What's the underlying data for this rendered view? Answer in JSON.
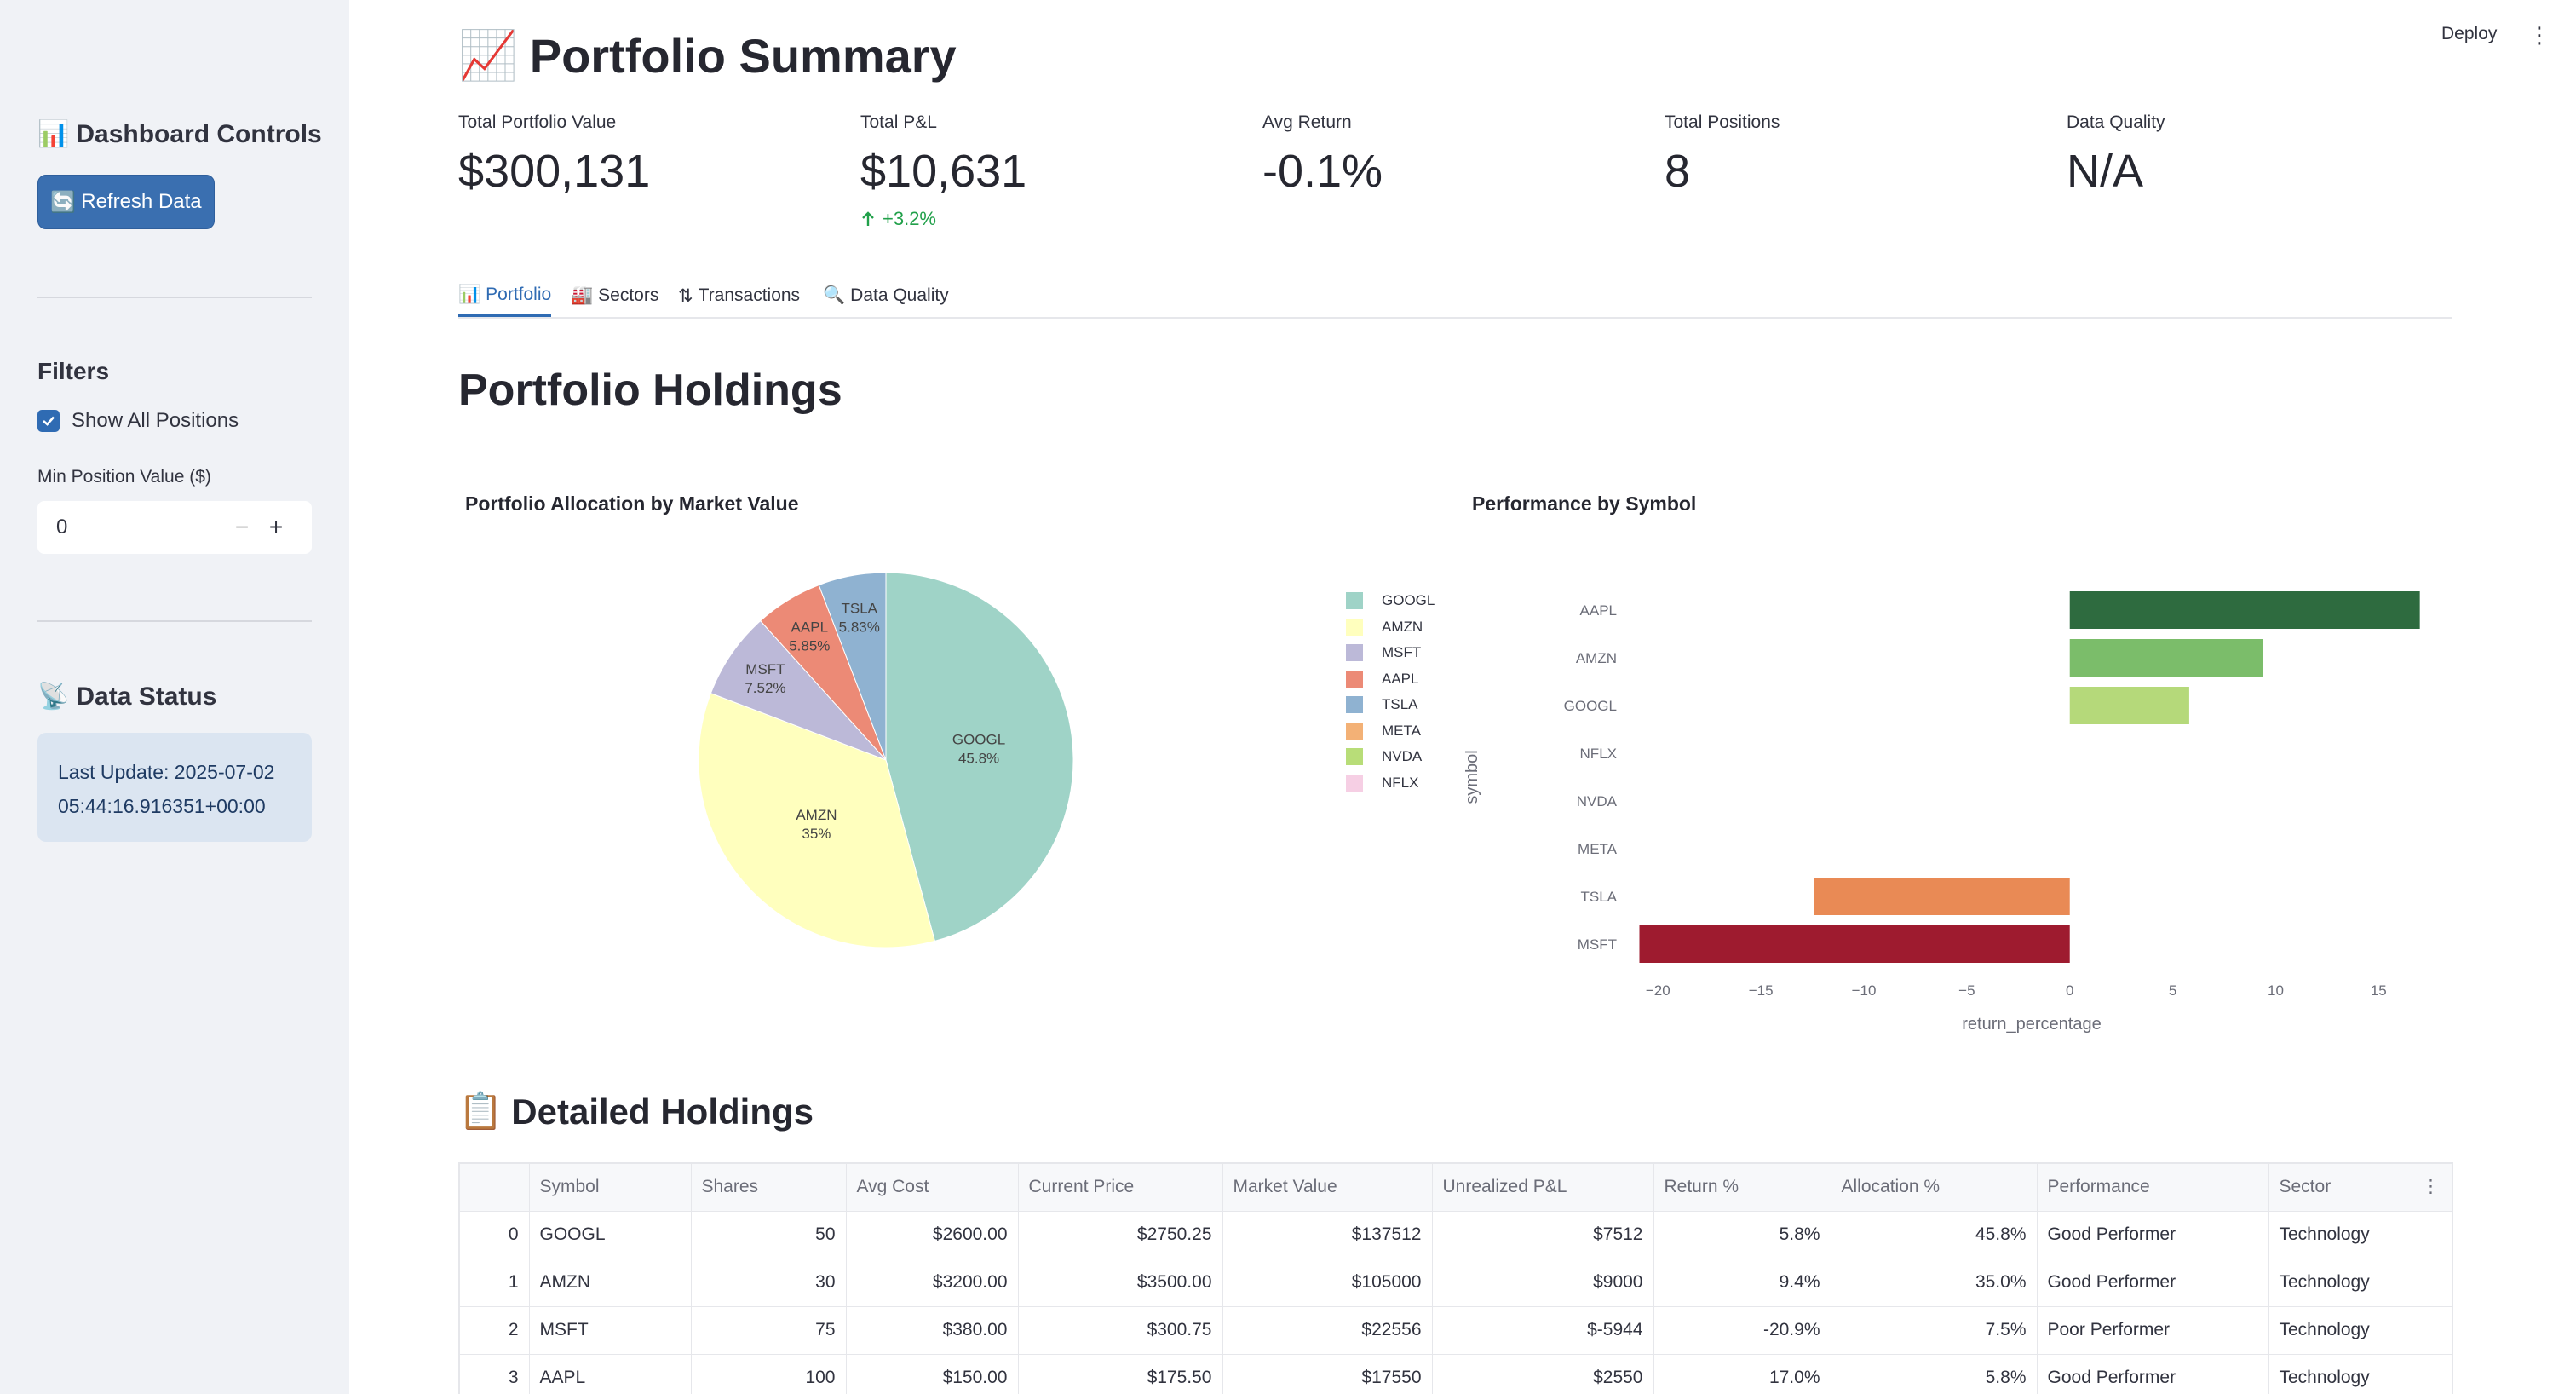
{
  "sidebar": {
    "controls_title": "Dashboard Controls",
    "refresh_label": "Refresh Data",
    "filters_title": "Filters",
    "show_all_label": "Show All Positions",
    "min_value_label": "Min Position Value ($)",
    "min_value": "0",
    "status_title": "Data Status",
    "last_update_line1": "Last Update: 2025-07-02",
    "last_update_line2": "05:44:16.916351+00:00"
  },
  "header": {
    "deploy_label": "Deploy"
  },
  "page": {
    "title": "Portfolio Summary"
  },
  "metrics": [
    {
      "label": "Total Portfolio Value",
      "value": "$300,131"
    },
    {
      "label": "Total P&L",
      "value": "$10,631",
      "delta": "+3.2%"
    },
    {
      "label": "Avg Return",
      "value": "-0.1%"
    },
    {
      "label": "Total Positions",
      "value": "8"
    },
    {
      "label": "Data Quality",
      "value": "N/A"
    }
  ],
  "tabs": [
    "Portfolio",
    "Sectors",
    "Transactions",
    "Data Quality"
  ],
  "section_title": "Portfolio Holdings",
  "detailed_title": "Detailed Holdings",
  "colors": {
    "accent": "#2f6bb3",
    "GOOGL": "#9fd3c7",
    "AMZN": "#ffffbe",
    "MSFT": "#bcb9d8",
    "AAPL": "#ec8a76",
    "TSLA": "#8fb2d1",
    "META": "#f3b176",
    "NVDA": "#b8dd78",
    "NFLX": "#f6cfe4"
  },
  "chart_data": [
    {
      "type": "pie",
      "title": "Portfolio Allocation by Market Value",
      "labels": [
        "GOOGL",
        "AMZN",
        "MSFT",
        "AAPL",
        "TSLA"
      ],
      "slice_labels": [
        "45.8%",
        "35%",
        "7.52%",
        "5.85%",
        "5.83%"
      ],
      "values": [
        45.8,
        35.0,
        7.52,
        5.85,
        5.83
      ],
      "legend": [
        "GOOGL",
        "AMZN",
        "MSFT",
        "AAPL",
        "TSLA",
        "META",
        "NVDA",
        "NFLX"
      ],
      "legend_position": "right"
    },
    {
      "type": "bar",
      "orientation": "horizontal",
      "title": "Performance by Symbol",
      "categories": [
        "AAPL",
        "AMZN",
        "GOOGL",
        "NFLX",
        "NVDA",
        "META",
        "TSLA",
        "MSFT"
      ],
      "values": [
        17.0,
        9.4,
        5.8,
        0,
        0,
        0,
        -12.4,
        -20.9
      ],
      "bar_colors": [
        "#2e6b3f",
        "#7bbd6a",
        "#b5d97a",
        "#ffffff",
        "#ffffff",
        "#ffffff",
        "#e98a55",
        "#9e1b2f"
      ],
      "xlabel": "return_percentage",
      "ylabel": "symbol",
      "xlim": [
        -21.5,
        17.8
      ],
      "xticks": [
        -20,
        -15,
        -10,
        -5,
        0,
        5,
        10,
        15
      ]
    }
  ],
  "table": {
    "columns": [
      "",
      "Symbol",
      "Shares",
      "Avg Cost",
      "Current Price",
      "Market Value",
      "Unrealized P&L",
      "Return %",
      "Allocation %",
      "Performance",
      "Sector"
    ],
    "rows": [
      [
        "0",
        "GOOGL",
        "50",
        "$2600.00",
        "$2750.25",
        "$137512",
        "$7512",
        "5.8%",
        "45.8%",
        "Good Performer",
        "Technology"
      ],
      [
        "1",
        "AMZN",
        "30",
        "$3200.00",
        "$3500.00",
        "$105000",
        "$9000",
        "9.4%",
        "35.0%",
        "Good Performer",
        "Technology"
      ],
      [
        "2",
        "MSFT",
        "75",
        "$380.00",
        "$300.75",
        "$22556",
        "$-5944",
        "-20.9%",
        "7.5%",
        "Poor Performer",
        "Technology"
      ],
      [
        "3",
        "AAPL",
        "100",
        "$150.00",
        "$175.50",
        "$17550",
        "$2550",
        "17.0%",
        "5.8%",
        "Good Performer",
        "Technology"
      ]
    ]
  }
}
